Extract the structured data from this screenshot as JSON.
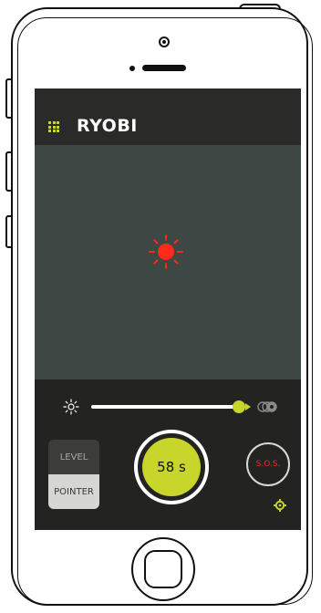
{
  "app": {
    "brand": "RYOBI",
    "accent_color": "#c8d62b",
    "light_color": "#ff2a1a"
  },
  "header": {
    "menu_icon": "grid-menu-icon",
    "logo_text": "RYOBI"
  },
  "viewport": {
    "indicator_icon": "light-on-icon"
  },
  "controls": {
    "brightness_icon": "brightness-icon",
    "brightness_level": 1.0,
    "beam_icon": "beam-mode-icon",
    "modes": [
      {
        "label": "LEVEL",
        "active": false
      },
      {
        "label": "POINTER",
        "active": true
      }
    ],
    "timer_label": "58 s",
    "sos_label": "S.O.S.",
    "settings_icon": "gear-icon"
  }
}
